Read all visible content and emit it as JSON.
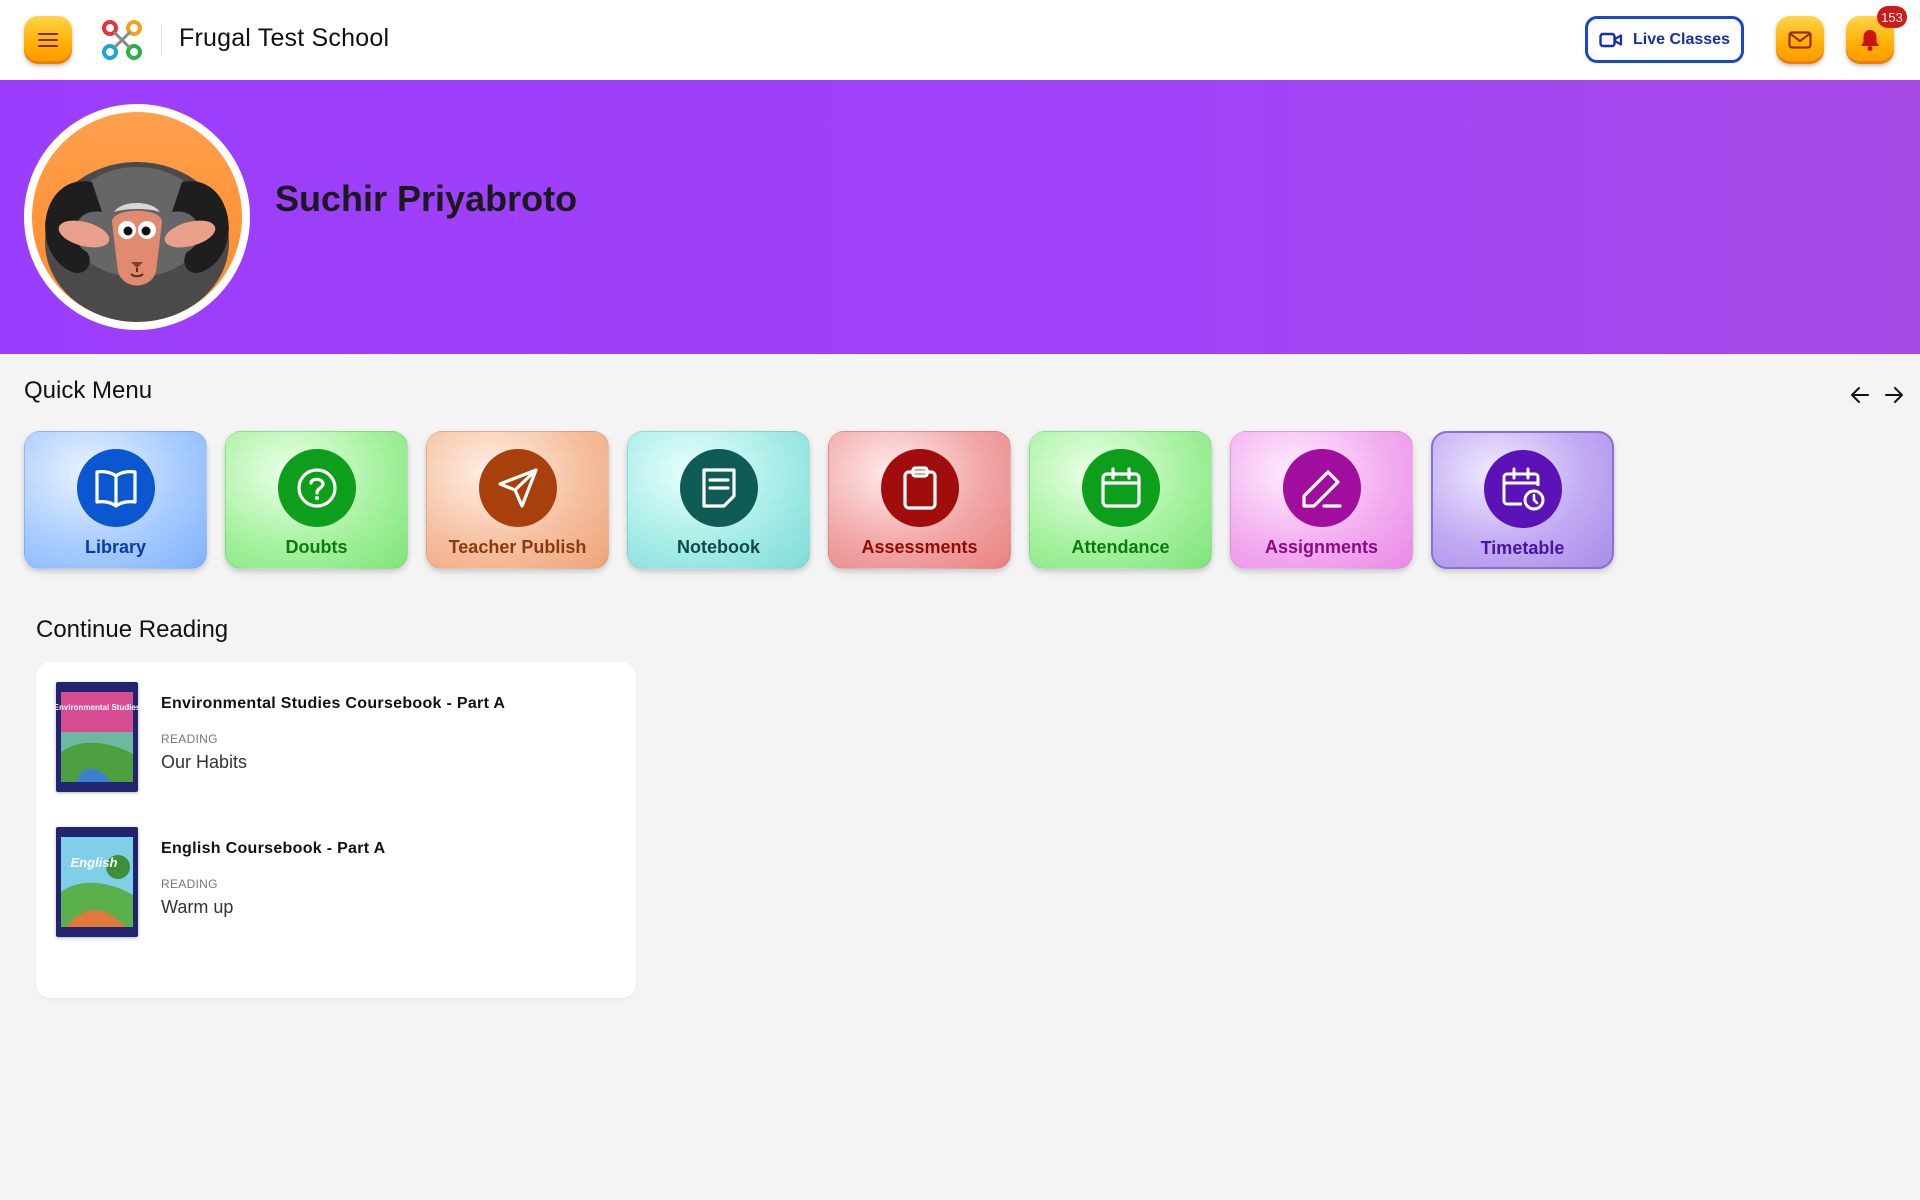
{
  "header": {
    "school_name": "Frugal Test School",
    "live_classes_label": "Live Classes",
    "notification_count": "153",
    "icons": {
      "menu": "hamburger-icon",
      "logo": "frugal-logo-icon",
      "live": "video-camera-icon",
      "mail": "mail-icon",
      "bell": "bell-icon"
    }
  },
  "banner": {
    "student_name": "Suchir Priyabroto",
    "avatar": "ram-avatar"
  },
  "quick_menu": {
    "title": "Quick Menu",
    "items": [
      {
        "label": "Library",
        "icon": "book-open-icon"
      },
      {
        "label": "Doubts",
        "icon": "question-circle-icon"
      },
      {
        "label": "Teacher Publish",
        "icon": "send-icon"
      },
      {
        "label": "Notebook",
        "icon": "note-icon"
      },
      {
        "label": "Assessments",
        "icon": "clipboard-icon"
      },
      {
        "label": "Attendance",
        "icon": "calendar-icon"
      },
      {
        "label": "Assignments",
        "icon": "pen-icon"
      },
      {
        "label": "Timetable",
        "icon": "calendar-clock-icon"
      }
    ]
  },
  "continue_reading": {
    "title": "Continue Reading",
    "books": [
      {
        "title": "Environmental Studies Coursebook - Part A",
        "status": "READING",
        "chapter": "Our Habits",
        "cover_text": "Environmental Studies"
      },
      {
        "title": "English Coursebook - Part A",
        "status": "READING",
        "chapter": "Warm up",
        "cover_text": "English"
      }
    ]
  },
  "colors": {
    "banner": "#a042f8",
    "accent_orange": "#ffae00",
    "live_blue": "#1646d6",
    "badge_red": "#d01a1a"
  }
}
